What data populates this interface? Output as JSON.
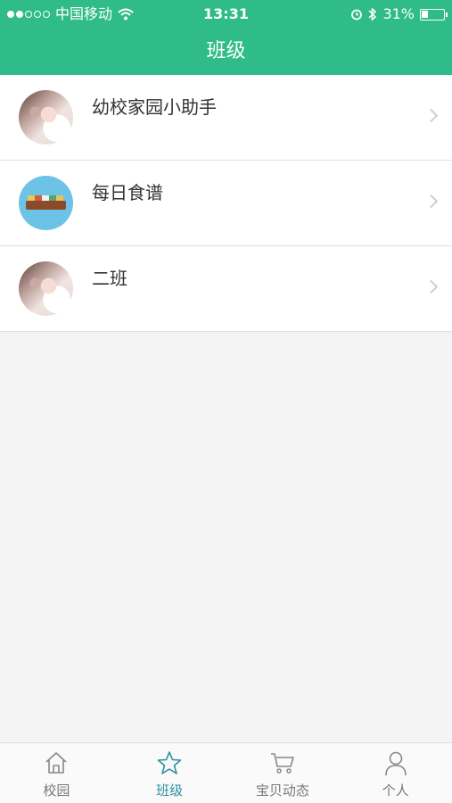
{
  "status_bar": {
    "carrier": "中国移动",
    "time": "13:31",
    "battery": "31%",
    "battery_level": 0.31
  },
  "nav": {
    "title": "班级"
  },
  "list": [
    {
      "label": "幼校家园小助手",
      "avatar": "cat-photo"
    },
    {
      "label": "每日食谱",
      "avatar": "food-photo"
    },
    {
      "label": "二班",
      "avatar": "cat-photo"
    }
  ],
  "tabbar": {
    "tabs": [
      {
        "label": "校园",
        "icon": "home-icon",
        "active": false
      },
      {
        "label": "班级",
        "icon": "star-icon",
        "active": true
      },
      {
        "label": "宝贝动态",
        "icon": "cart-icon",
        "active": false
      },
      {
        "label": "个人",
        "icon": "person-icon",
        "active": false
      }
    ]
  },
  "colors": {
    "header": "#2fbc8a",
    "active_tab": "#2a8fa3"
  }
}
